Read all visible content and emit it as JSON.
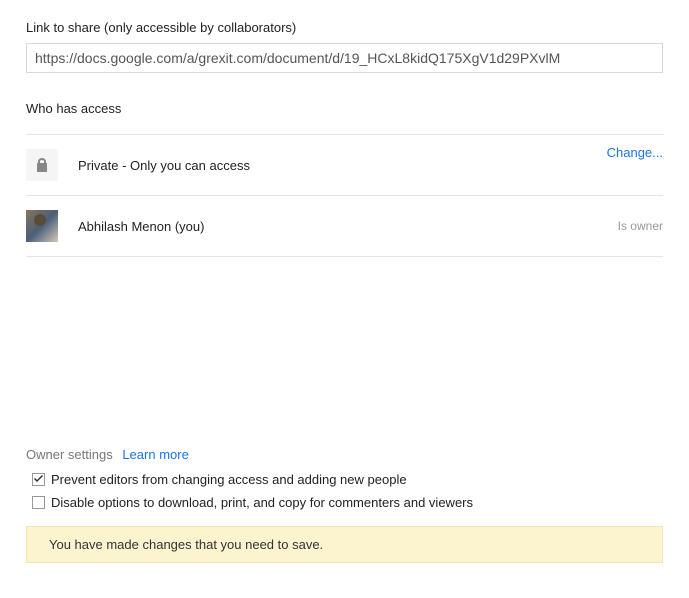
{
  "link_section": {
    "label": "Link to share (only accessible by collaborators)",
    "url": "https://docs.google.com/a/grexit.com/document/d/19_HCxL8kidQ175XgV1d29PXvlM"
  },
  "access": {
    "heading": "Who has access",
    "privacy_text": "Private - Only you can access",
    "change_label": "Change...",
    "user_name": "Abhilash Menon (you)",
    "owner_label": "Is owner"
  },
  "owner_settings": {
    "label": "Owner settings",
    "learn_more": "Learn more",
    "prevent_editors": "Prevent editors from changing access and adding new people",
    "disable_download": "Disable options to download, print, and copy for commenters and viewers"
  },
  "notice": "You have made changes that you need to save."
}
